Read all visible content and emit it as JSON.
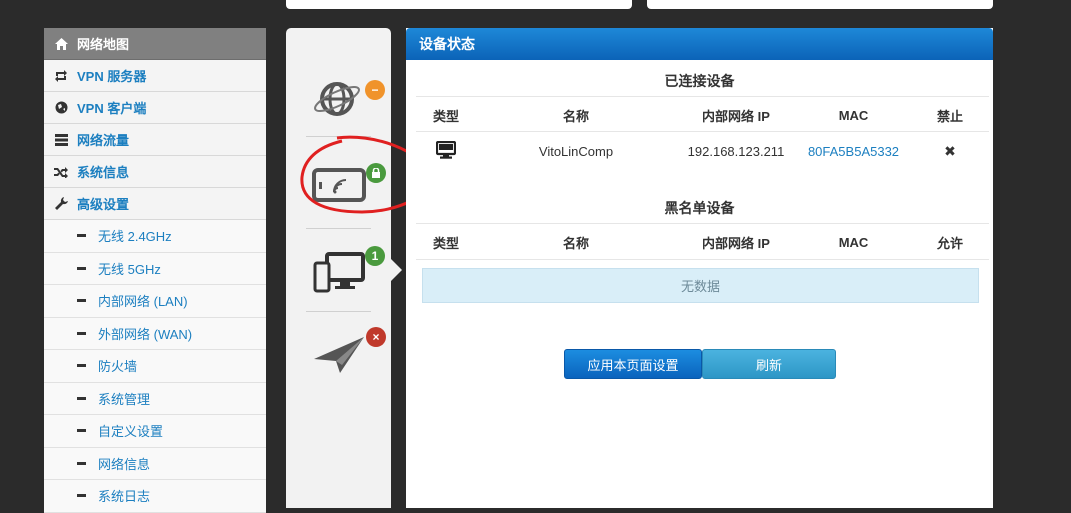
{
  "sidebar": {
    "items": [
      {
        "label": "网络地图",
        "icon": "home-icon",
        "active": true
      },
      {
        "label": "VPN 服务器",
        "icon": "loop-icon"
      },
      {
        "label": "VPN 客户端",
        "icon": "globe-icon"
      },
      {
        "label": "网络流量",
        "icon": "list-icon"
      },
      {
        "label": "系统信息",
        "icon": "shuffle-icon"
      },
      {
        "label": "高级设置",
        "icon": "wrench-icon"
      }
    ],
    "subitems": [
      {
        "label": "无线 2.4GHz"
      },
      {
        "label": "无线 5GHz"
      },
      {
        "label": "内部网络 (LAN)"
      },
      {
        "label": "外部网络 (WAN)"
      },
      {
        "label": "防火墙"
      },
      {
        "label": "系统管理"
      },
      {
        "label": "自定义设置"
      },
      {
        "label": "网络信息"
      },
      {
        "label": "系统日志"
      }
    ]
  },
  "icon_column": {
    "badges": {
      "globe": "−",
      "phone": "🔒",
      "devices": "1",
      "plane": "×"
    },
    "colors": {
      "globe": "#f0932b",
      "phone": "#4a9a3e",
      "devices": "#4a9a3e",
      "plane": "#c0392b"
    }
  },
  "panel": {
    "title": "设备状态",
    "connected_title": "已连接设备",
    "connected_headers": [
      "类型",
      "名称",
      "内部网络 IP",
      "MAC",
      "禁止"
    ],
    "connected_rows": [
      {
        "name": "VitoLinComp",
        "ip": "192.168.123.211",
        "mac": "80FA5B5A5332",
        "action": "✖"
      }
    ],
    "blacklist_title": "黑名单设备",
    "blacklist_headers": [
      "类型",
      "名称",
      "内部网络 IP",
      "MAC",
      "允许"
    ],
    "empty_text": "无数据",
    "apply_label": "应用本页面设置",
    "refresh_label": "刷新"
  }
}
